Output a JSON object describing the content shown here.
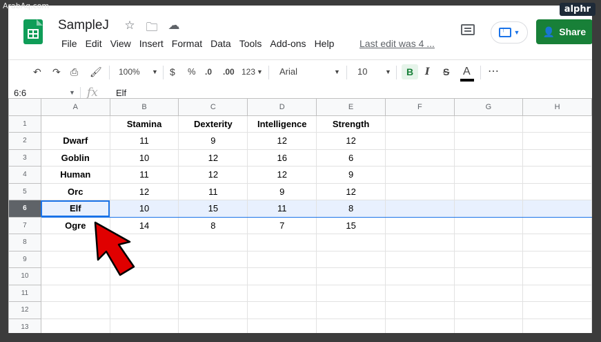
{
  "watermark": {
    "left": "ArabAq.com",
    "right": "alphr"
  },
  "doc": {
    "title": "SampleJ",
    "last_edit": "Last edit was 4 ..."
  },
  "title_icons": [
    "star-icon",
    "folder-icon",
    "cloud-status-icon"
  ],
  "menu": [
    "File",
    "Edit",
    "View",
    "Insert",
    "Format",
    "Data",
    "Tools",
    "Add-ons",
    "Help"
  ],
  "share": {
    "label": "Share"
  },
  "toolbar": {
    "zoom": "100%",
    "currency": "$",
    "percent": "%",
    "dec_decrease": ".0",
    "dec_increase": ".00",
    "more_formats": "123",
    "font": "Arial",
    "font_size": "10",
    "bold": "B",
    "italic": "I",
    "strike": "S",
    "text_color": "A",
    "more": "⋯"
  },
  "formula": {
    "name_box": "6:6",
    "fx": "fx",
    "value": "Elf"
  },
  "columns": [
    "A",
    "B",
    "C",
    "D",
    "E",
    "F",
    "G",
    "H"
  ],
  "rows": [
    [
      "",
      "Stamina",
      "Dexterity",
      "Intelligence",
      "Strength",
      "",
      "",
      ""
    ],
    [
      "Dwarf",
      "11",
      "9",
      "12",
      "12",
      "",
      "",
      ""
    ],
    [
      "Goblin",
      "10",
      "12",
      "16",
      "6",
      "",
      "",
      ""
    ],
    [
      "Human",
      "11",
      "12",
      "12",
      "9",
      "",
      "",
      ""
    ],
    [
      "Orc",
      "12",
      "11",
      "9",
      "12",
      "",
      "",
      ""
    ],
    [
      "Elf",
      "10",
      "15",
      "11",
      "8",
      "",
      "",
      ""
    ],
    [
      "Ogre",
      "14",
      "8",
      "7",
      "15",
      "",
      "",
      ""
    ],
    [
      "",
      "",
      "",
      "",
      "",
      "",
      "",
      ""
    ],
    [
      "",
      "",
      "",
      "",
      "",
      "",
      "",
      ""
    ],
    [
      "",
      "",
      "",
      "",
      "",
      "",
      "",
      ""
    ],
    [
      "",
      "",
      "",
      "",
      "",
      "",
      "",
      ""
    ],
    [
      "",
      "",
      "",
      "",
      "",
      "",
      "",
      ""
    ],
    [
      "",
      "",
      "",
      "",
      "",
      "",
      "",
      ""
    ]
  ],
  "row_numbers": [
    "1",
    "2",
    "3",
    "4",
    "5",
    "6",
    "7",
    "8",
    "9",
    "10",
    "11",
    "12",
    "13"
  ],
  "selected_row": 6,
  "colors": {
    "brand_green": "#0f9d58",
    "share_green": "#188038",
    "selection_blue": "#1a73e8",
    "arrow_red": "#e00000"
  }
}
